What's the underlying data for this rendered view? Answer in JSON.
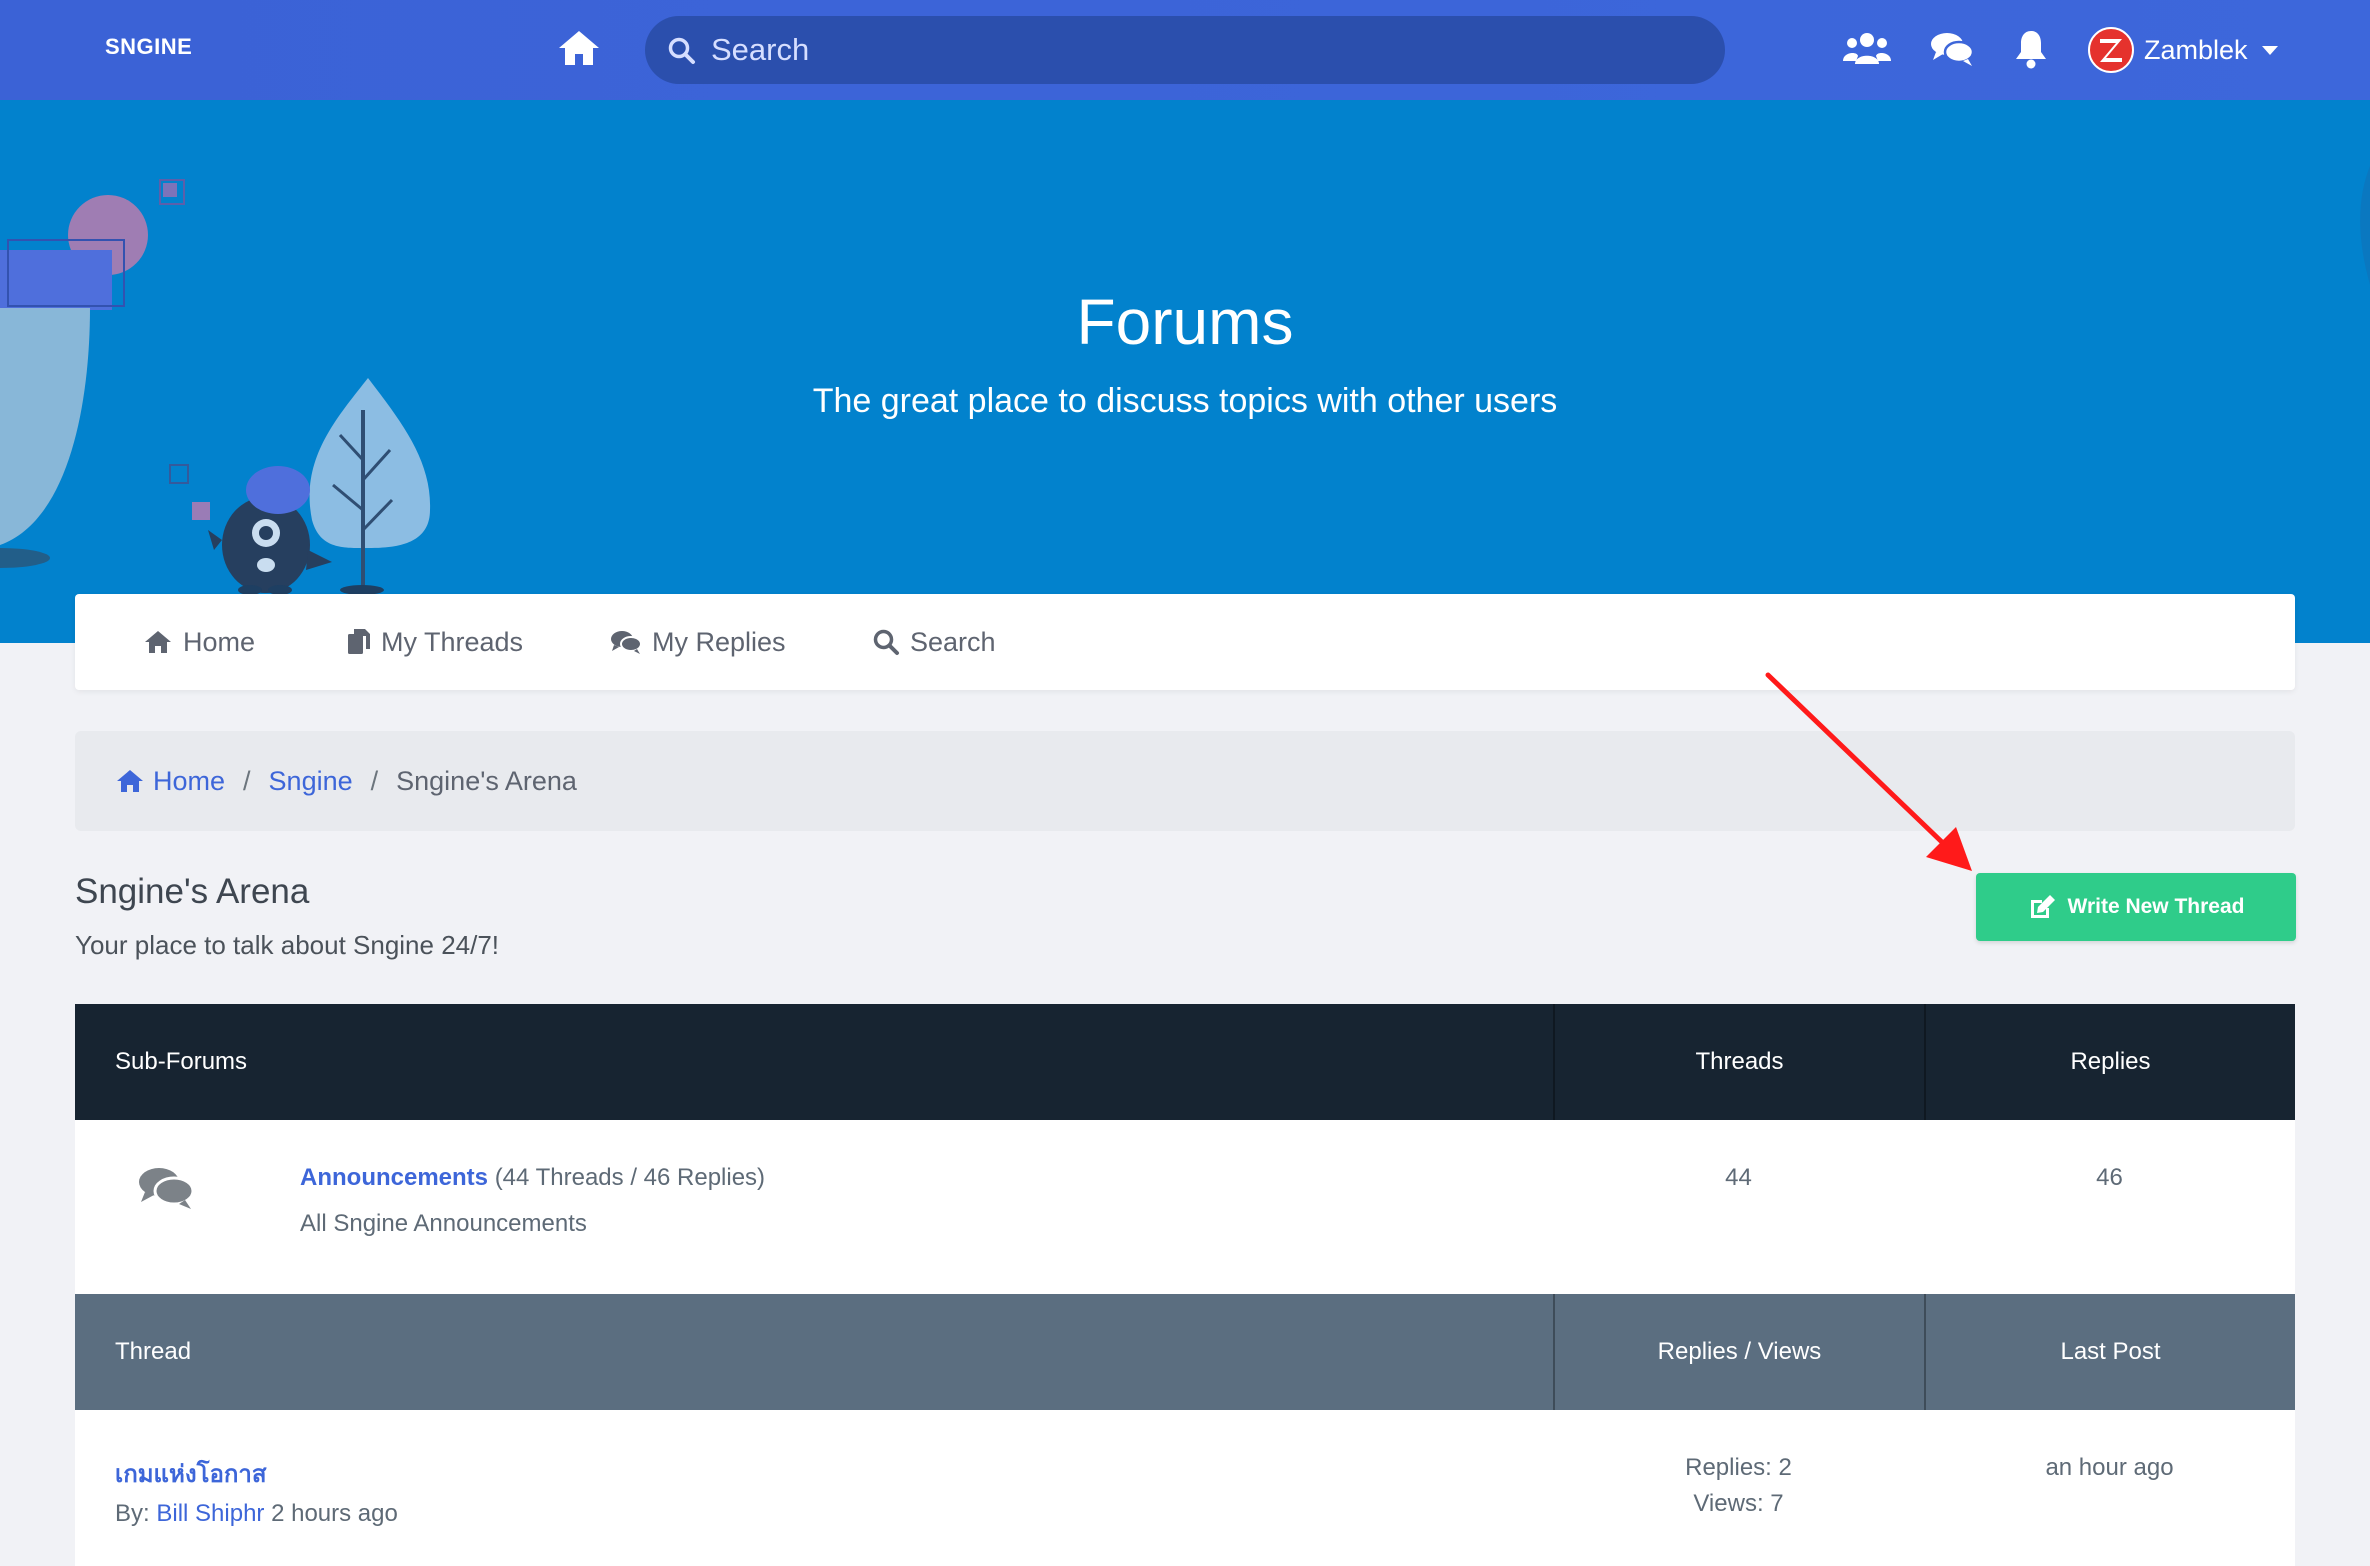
{
  "navbar": {
    "brand": "SNGINE",
    "search_placeholder": "Search",
    "user_name": "Zamblek",
    "icons": [
      "home-icon",
      "search-icon",
      "users-icon",
      "chat-icon",
      "bell-icon",
      "avatar-z-logo",
      "caret-down-icon"
    ]
  },
  "hero": {
    "title": "Forums",
    "subtitle": "The great place to discuss topics with other users"
  },
  "tabs": [
    {
      "label": "Home",
      "icon": "home-icon"
    },
    {
      "label": "My Threads",
      "icon": "copy-icon"
    },
    {
      "label": "My Replies",
      "icon": "comments-icon"
    },
    {
      "label": "Search",
      "icon": "search-icon"
    }
  ],
  "breadcrumb": {
    "home": "Home",
    "parent": "Sngine",
    "current": "Sngine's Arena",
    "separator": "/"
  },
  "forum": {
    "title": "Sngine's Arena",
    "description": "Your place to talk about Sngine 24/7!",
    "write_button": "Write New Thread"
  },
  "subforums_table": {
    "headers": [
      "Sub-Forums",
      "Threads",
      "Replies"
    ],
    "rows": [
      {
        "name": "Announcements",
        "meta": "(44 Threads / 46 Replies)",
        "description": "All Sngine Announcements",
        "threads": "44",
        "replies": "46"
      }
    ]
  },
  "threads_table": {
    "headers": [
      "Thread",
      "Replies / Views",
      "Last Post"
    ],
    "rows": [
      {
        "title": "เกมแห่งโอกาส",
        "by_label": "By:",
        "author": "Bill Shiphr",
        "time": "2 hours ago",
        "replies": "Replies: 2",
        "views": "Views: 7",
        "last_post": "an hour ago"
      }
    ]
  },
  "colors": {
    "navbar": "#3d66d9",
    "hero": "#0282cd",
    "accent_link": "#3d66d9",
    "write_button": "#2fcc8a",
    "table_head_dark": "#172431",
    "table_head_slate": "#5b6e80",
    "annotation_arrow": "#ff1a1a"
  }
}
